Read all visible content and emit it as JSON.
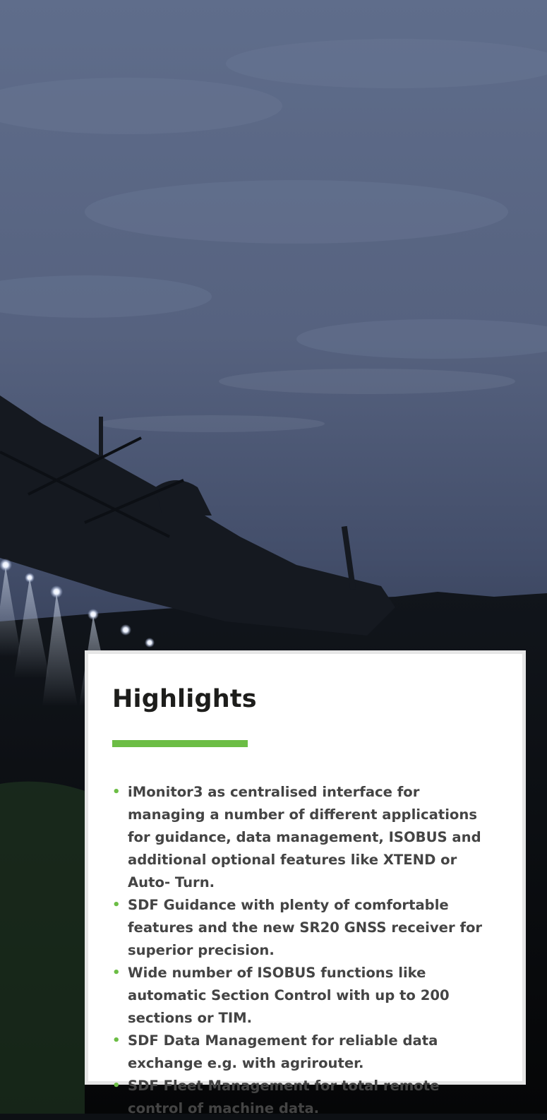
{
  "hero": {
    "description_icon": "crop-sprayer-at-dusk-photo"
  },
  "highlights": {
    "title": "Highlights",
    "accent_color": "#6cbd45",
    "items": [
      "iMonitor3 as centralised interface for managing a number of different applications for guidance, data management, ISOBUS and additional optional features like XTEND or Auto- Turn.",
      "SDF Guidance with plenty of comfortable features and the new SR20 GNSS receiver for superior precision.",
      "Wide number of ISOBUS functions like automatic Section Control with up to 200 sections or TIM.",
      "SDF Data Management for reliable data exchange e.g. with agrirouter.",
      "SDF Fleet Management for total remote control of machine data."
    ]
  }
}
